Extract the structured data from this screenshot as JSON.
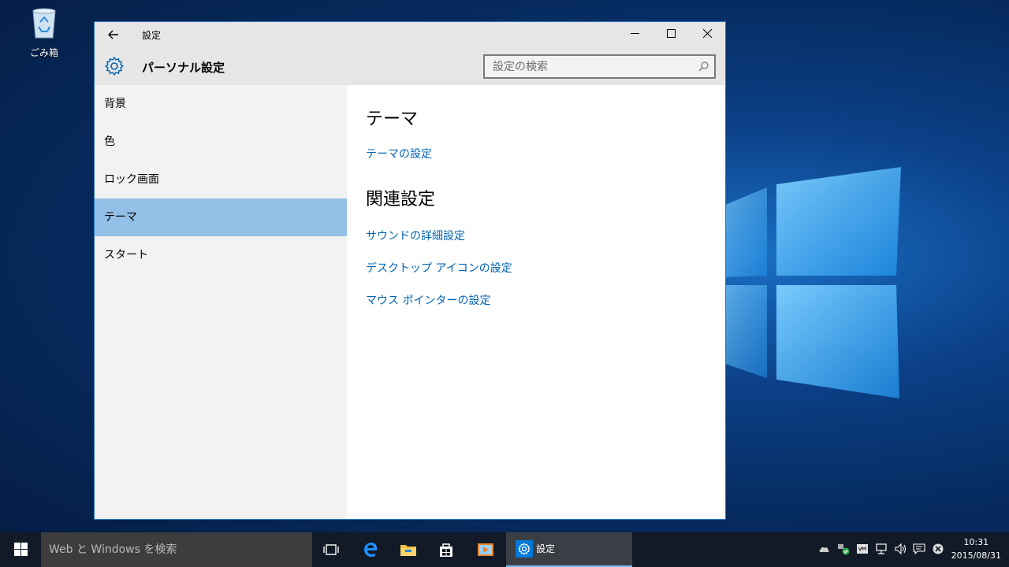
{
  "desktop": {
    "recycle_bin_label": "ごみ箱"
  },
  "window": {
    "title": "設定",
    "header_title": "パーソナル設定",
    "search_placeholder": "設定の検索"
  },
  "sidebar": {
    "items": [
      {
        "label": "背景",
        "active": false
      },
      {
        "label": "色",
        "active": false
      },
      {
        "label": "ロック画面",
        "active": false
      },
      {
        "label": "テーマ",
        "active": true
      },
      {
        "label": "スタート",
        "active": false
      }
    ]
  },
  "content": {
    "heading": "テーマ",
    "theme_link": "テーマの設定",
    "related_heading": "関連設定",
    "related_links": [
      "サウンドの詳細設定",
      "デスクトップ アイコンの設定",
      "マウス ポインターの設定"
    ]
  },
  "taskbar": {
    "search_text": "Web と Windows を検索",
    "active_app_label": "設定",
    "clock_time": "10:31",
    "clock_date": "2015/08/31"
  },
  "colors": {
    "accent": "#0078d7",
    "link": "#0063b1",
    "active_nav": "#93c0e6"
  }
}
